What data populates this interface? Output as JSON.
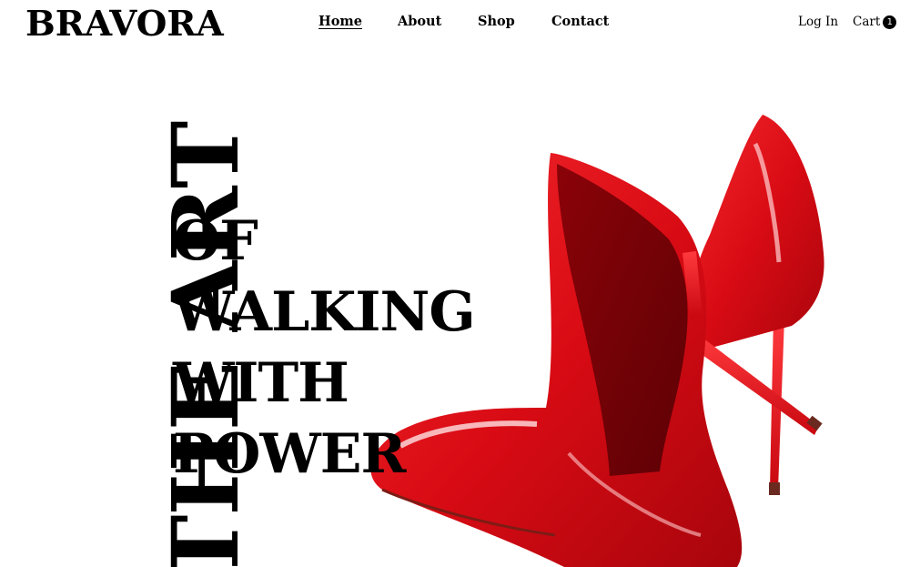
{
  "brand": {
    "name": "BRAVORA"
  },
  "nav": {
    "items": [
      {
        "label": "Home",
        "active": true
      },
      {
        "label": "About"
      },
      {
        "label": "Shop"
      },
      {
        "label": "Contact"
      }
    ]
  },
  "account": {
    "login_label": "Log In",
    "cart_label": "Cart",
    "cart_count": "1"
  },
  "hero": {
    "vertical_text": "THE ART",
    "lines": [
      "OF",
      "WALKING",
      "WITH",
      "POWER"
    ],
    "image": "red-high-heels-image"
  },
  "colors": {
    "text": "#000000",
    "background": "#ffffff",
    "shoe_red": "#e1101a"
  }
}
